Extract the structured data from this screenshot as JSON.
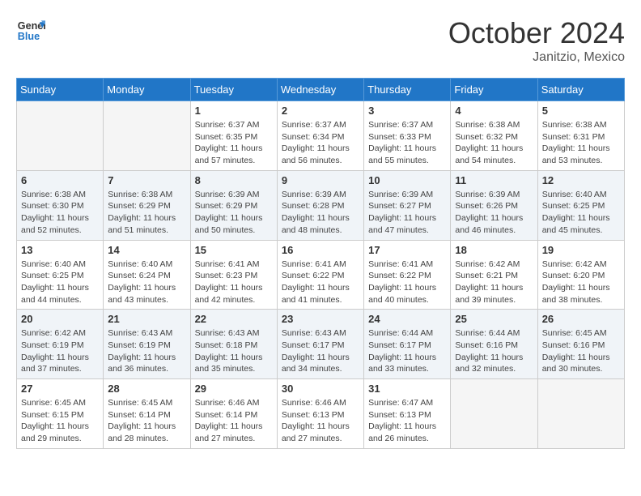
{
  "header": {
    "logo_line1": "General",
    "logo_line2": "Blue",
    "month": "October 2024",
    "location": "Janitzio, Mexico"
  },
  "days_of_week": [
    "Sunday",
    "Monday",
    "Tuesday",
    "Wednesday",
    "Thursday",
    "Friday",
    "Saturday"
  ],
  "weeks": [
    [
      {
        "day": "",
        "empty": true
      },
      {
        "day": "",
        "empty": true
      },
      {
        "day": "1",
        "sunrise": "Sunrise: 6:37 AM",
        "sunset": "Sunset: 6:35 PM",
        "daylight": "Daylight: 11 hours and 57 minutes."
      },
      {
        "day": "2",
        "sunrise": "Sunrise: 6:37 AM",
        "sunset": "Sunset: 6:34 PM",
        "daylight": "Daylight: 11 hours and 56 minutes."
      },
      {
        "day": "3",
        "sunrise": "Sunrise: 6:37 AM",
        "sunset": "Sunset: 6:33 PM",
        "daylight": "Daylight: 11 hours and 55 minutes."
      },
      {
        "day": "4",
        "sunrise": "Sunrise: 6:38 AM",
        "sunset": "Sunset: 6:32 PM",
        "daylight": "Daylight: 11 hours and 54 minutes."
      },
      {
        "day": "5",
        "sunrise": "Sunrise: 6:38 AM",
        "sunset": "Sunset: 6:31 PM",
        "daylight": "Daylight: 11 hours and 53 minutes."
      }
    ],
    [
      {
        "day": "6",
        "sunrise": "Sunrise: 6:38 AM",
        "sunset": "Sunset: 6:30 PM",
        "daylight": "Daylight: 11 hours and 52 minutes."
      },
      {
        "day": "7",
        "sunrise": "Sunrise: 6:38 AM",
        "sunset": "Sunset: 6:29 PM",
        "daylight": "Daylight: 11 hours and 51 minutes."
      },
      {
        "day": "8",
        "sunrise": "Sunrise: 6:39 AM",
        "sunset": "Sunset: 6:29 PM",
        "daylight": "Daylight: 11 hours and 50 minutes."
      },
      {
        "day": "9",
        "sunrise": "Sunrise: 6:39 AM",
        "sunset": "Sunset: 6:28 PM",
        "daylight": "Daylight: 11 hours and 48 minutes."
      },
      {
        "day": "10",
        "sunrise": "Sunrise: 6:39 AM",
        "sunset": "Sunset: 6:27 PM",
        "daylight": "Daylight: 11 hours and 47 minutes."
      },
      {
        "day": "11",
        "sunrise": "Sunrise: 6:39 AM",
        "sunset": "Sunset: 6:26 PM",
        "daylight": "Daylight: 11 hours and 46 minutes."
      },
      {
        "day": "12",
        "sunrise": "Sunrise: 6:40 AM",
        "sunset": "Sunset: 6:25 PM",
        "daylight": "Daylight: 11 hours and 45 minutes."
      }
    ],
    [
      {
        "day": "13",
        "sunrise": "Sunrise: 6:40 AM",
        "sunset": "Sunset: 6:25 PM",
        "daylight": "Daylight: 11 hours and 44 minutes."
      },
      {
        "day": "14",
        "sunrise": "Sunrise: 6:40 AM",
        "sunset": "Sunset: 6:24 PM",
        "daylight": "Daylight: 11 hours and 43 minutes."
      },
      {
        "day": "15",
        "sunrise": "Sunrise: 6:41 AM",
        "sunset": "Sunset: 6:23 PM",
        "daylight": "Daylight: 11 hours and 42 minutes."
      },
      {
        "day": "16",
        "sunrise": "Sunrise: 6:41 AM",
        "sunset": "Sunset: 6:22 PM",
        "daylight": "Daylight: 11 hours and 41 minutes."
      },
      {
        "day": "17",
        "sunrise": "Sunrise: 6:41 AM",
        "sunset": "Sunset: 6:22 PM",
        "daylight": "Daylight: 11 hours and 40 minutes."
      },
      {
        "day": "18",
        "sunrise": "Sunrise: 6:42 AM",
        "sunset": "Sunset: 6:21 PM",
        "daylight": "Daylight: 11 hours and 39 minutes."
      },
      {
        "day": "19",
        "sunrise": "Sunrise: 6:42 AM",
        "sunset": "Sunset: 6:20 PM",
        "daylight": "Daylight: 11 hours and 38 minutes."
      }
    ],
    [
      {
        "day": "20",
        "sunrise": "Sunrise: 6:42 AM",
        "sunset": "Sunset: 6:19 PM",
        "daylight": "Daylight: 11 hours and 37 minutes."
      },
      {
        "day": "21",
        "sunrise": "Sunrise: 6:43 AM",
        "sunset": "Sunset: 6:19 PM",
        "daylight": "Daylight: 11 hours and 36 minutes."
      },
      {
        "day": "22",
        "sunrise": "Sunrise: 6:43 AM",
        "sunset": "Sunset: 6:18 PM",
        "daylight": "Daylight: 11 hours and 35 minutes."
      },
      {
        "day": "23",
        "sunrise": "Sunrise: 6:43 AM",
        "sunset": "Sunset: 6:17 PM",
        "daylight": "Daylight: 11 hours and 34 minutes."
      },
      {
        "day": "24",
        "sunrise": "Sunrise: 6:44 AM",
        "sunset": "Sunset: 6:17 PM",
        "daylight": "Daylight: 11 hours and 33 minutes."
      },
      {
        "day": "25",
        "sunrise": "Sunrise: 6:44 AM",
        "sunset": "Sunset: 6:16 PM",
        "daylight": "Daylight: 11 hours and 32 minutes."
      },
      {
        "day": "26",
        "sunrise": "Sunrise: 6:45 AM",
        "sunset": "Sunset: 6:16 PM",
        "daylight": "Daylight: 11 hours and 30 minutes."
      }
    ],
    [
      {
        "day": "27",
        "sunrise": "Sunrise: 6:45 AM",
        "sunset": "Sunset: 6:15 PM",
        "daylight": "Daylight: 11 hours and 29 minutes."
      },
      {
        "day": "28",
        "sunrise": "Sunrise: 6:45 AM",
        "sunset": "Sunset: 6:14 PM",
        "daylight": "Daylight: 11 hours and 28 minutes."
      },
      {
        "day": "29",
        "sunrise": "Sunrise: 6:46 AM",
        "sunset": "Sunset: 6:14 PM",
        "daylight": "Daylight: 11 hours and 27 minutes."
      },
      {
        "day": "30",
        "sunrise": "Sunrise: 6:46 AM",
        "sunset": "Sunset: 6:13 PM",
        "daylight": "Daylight: 11 hours and 27 minutes."
      },
      {
        "day": "31",
        "sunrise": "Sunrise: 6:47 AM",
        "sunset": "Sunset: 6:13 PM",
        "daylight": "Daylight: 11 hours and 26 minutes."
      },
      {
        "day": "",
        "empty": true
      },
      {
        "day": "",
        "empty": true
      }
    ]
  ]
}
